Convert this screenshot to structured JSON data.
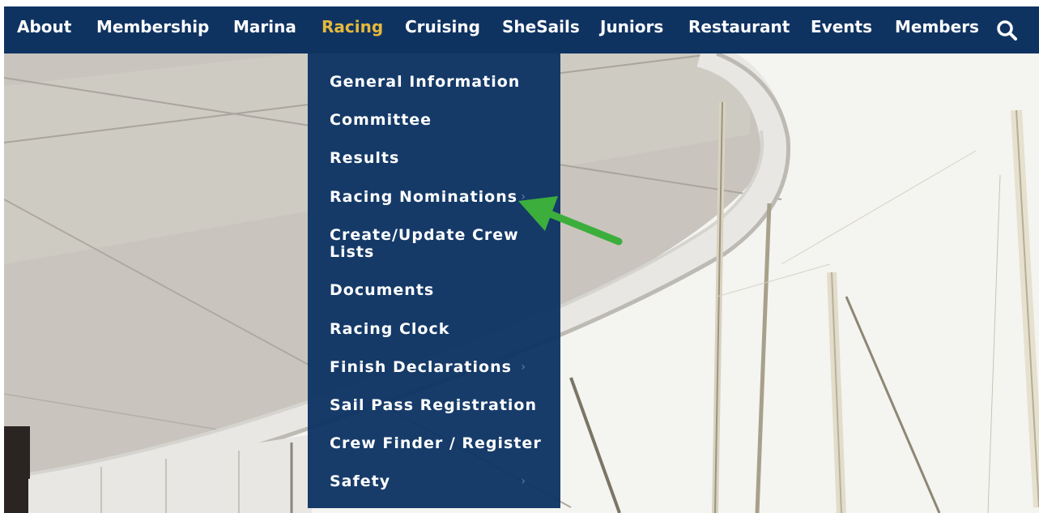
{
  "nav": {
    "items": [
      {
        "label": "About"
      },
      {
        "label": "Membership"
      },
      {
        "label": "Marina"
      },
      {
        "label": "Racing"
      },
      {
        "label": "Cruising"
      },
      {
        "label": "SheSails"
      },
      {
        "label": "Juniors"
      },
      {
        "label": "Restaurant"
      },
      {
        "label": "Events"
      },
      {
        "label": "Members"
      }
    ],
    "active_label": "Racing",
    "search_icon": "search-icon"
  },
  "dropdown": {
    "items": [
      {
        "label": "General Information",
        "has_submenu": false
      },
      {
        "label": "Committee",
        "has_submenu": false
      },
      {
        "label": "Results",
        "has_submenu": false
      },
      {
        "label": "Racing Nominations",
        "has_submenu": true
      },
      {
        "label": "Create/Update Crew Lists",
        "has_submenu": false
      },
      {
        "label": "Documents",
        "has_submenu": false
      },
      {
        "label": "Racing Clock",
        "has_submenu": false
      },
      {
        "label": "Finish Declarations",
        "has_submenu": true
      },
      {
        "label": "Sail Pass Registration",
        "has_submenu": false
      },
      {
        "label": "Crew Finder / Register",
        "has_submenu": false
      },
      {
        "label": "Safety",
        "has_submenu": true
      }
    ],
    "chevron_glyph": "›"
  },
  "colors": {
    "nav_bg": "#0f3361",
    "nav_text": "#ffffff",
    "nav_active": "#e6b93c",
    "dropdown_bg": "#0e3464",
    "annotation_arrow": "#3cae3c"
  }
}
